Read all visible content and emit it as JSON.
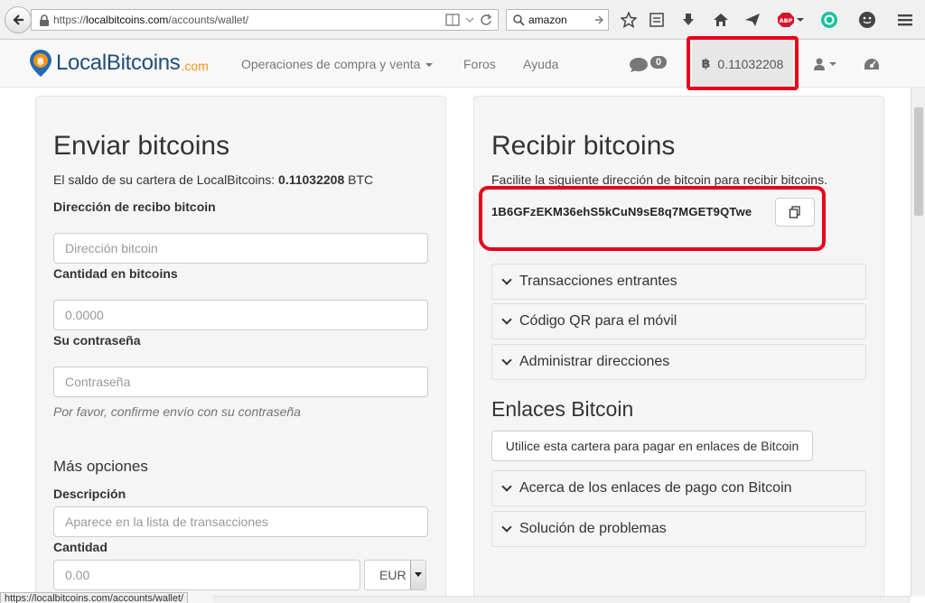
{
  "browser": {
    "url_prefix": "https://",
    "url_domain": "localbitcoins.com",
    "url_path": "/accounts/wallet/",
    "search_value": "amazon",
    "abp_label": "ABP",
    "status_url": "https://localbitcoins.com/accounts/wallet/"
  },
  "nav": {
    "logo_text": "LocalBitcoins",
    "logo_suffix": ".com",
    "menu_trade": "Operaciones de compra y venta",
    "menu_forums": "Foros",
    "menu_help": "Ayuda",
    "messages_count": "0",
    "btc_symbol": "฿",
    "balance": "0.11032208"
  },
  "send": {
    "title": "Enviar bitcoins",
    "balance_text_prefix": "El saldo de su cartera de LocalBitcoins: ",
    "balance_value": "0.11032208",
    "balance_unit": " BTC",
    "address_label": "Dirección de recibo bitcoin",
    "address_placeholder": "Dirección bitcoin",
    "amount_label": "Cantidad en bitcoins",
    "amount_placeholder": "0.0000",
    "password_label": "Su contraseña",
    "password_placeholder": "Contraseña",
    "password_help": "Por favor, confirme envío con su contraseña",
    "more_options": "Más opciones",
    "description_label": "Descripción",
    "description_placeholder": "Aparece en la lista de transacciones",
    "quantity_label": "Cantidad",
    "quantity_placeholder": "0.00",
    "currency": "EUR"
  },
  "receive": {
    "title": "Recibir bitcoins",
    "intro": "Facilite la siguiente dirección de bitcoin para recibir bitcoins.",
    "address": "1B6GFzEKM36ehS5kCuN9sE8q7MGET9QTwe",
    "sections": [
      "Transacciones entrantes",
      "Código QR para el móvil",
      "Administrar direcciones"
    ],
    "links_title": "Enlaces Bitcoin",
    "links_button": "Utilice esta cartera para pagar en enlaces de Bitcoin",
    "links_sections": [
      "Acerca de los enlaces de pago con Bitcoin",
      "Solución de problemas"
    ]
  },
  "colors": {
    "highlight_red": "#e8001c",
    "logo_blue": "#1f4e79",
    "logo_orange": "#f7931a"
  }
}
